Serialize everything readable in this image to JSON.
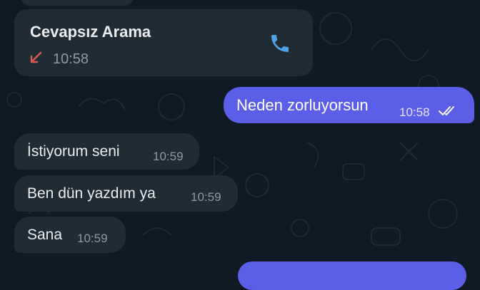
{
  "colors": {
    "background": "#0f1a24",
    "incoming_bubble": "#1f2c36",
    "outgoing_bubble": "#5b5ee6",
    "missed_call_arrow": "#e0574f",
    "call_icon": "#4fa3e6"
  },
  "call": {
    "title": "Cevapsız Arama",
    "time": "10:58",
    "direction_icon": "arrow-down-left-icon",
    "action_icon": "phone-icon"
  },
  "messages": [
    {
      "direction": "out",
      "text": "Neden zorluyorsun",
      "time": "10:58",
      "status": "read",
      "status_icon": "double-check-icon"
    },
    {
      "direction": "in",
      "text": "İstiyorum seni",
      "time": "10:59"
    },
    {
      "direction": "in",
      "text": "Ben dün yazdım ya",
      "time": "10:59"
    },
    {
      "direction": "in",
      "text": "Sana",
      "time": "10:59"
    }
  ]
}
